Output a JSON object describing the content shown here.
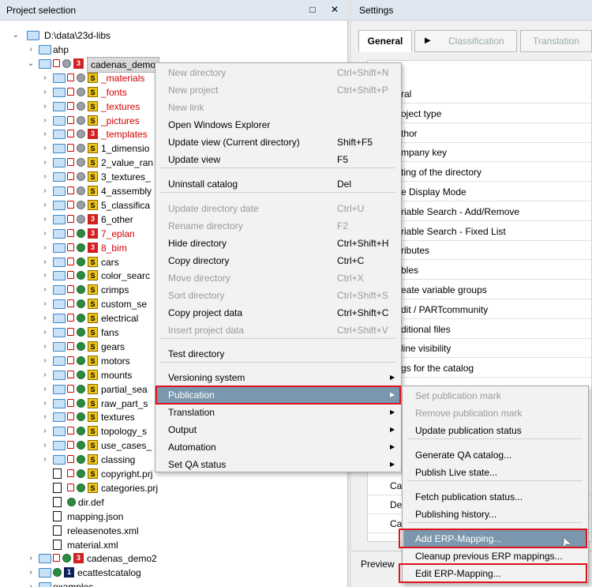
{
  "left_panel": {
    "title": "Project selection",
    "restore_icon": "□",
    "close_icon": "✕"
  },
  "right_panel": {
    "title": "Settings",
    "tabs": [
      {
        "label": "General",
        "active": true
      },
      {
        "label": "Classification",
        "active": false
      },
      {
        "label": "Translation",
        "active": false
      }
    ],
    "tab_play_icon": "▶",
    "properties": [
      "ral",
      "oject type",
      "thor",
      "mpany key",
      "ting of the directory",
      "e Display Mode",
      "riable Search - Add/Remove",
      "riable Search - Fixed List",
      "ributes",
      "bles",
      "eate variable groups",
      "dit / PARTcommunity",
      "ditional files",
      "line visibility",
      "gs for the catalog"
    ],
    "partial_rows": [
      "Ca",
      "De",
      "Ca"
    ],
    "preview_label": "Preview"
  },
  "tree": {
    "root": "D:\\data\\23d-libs",
    "items": [
      {
        "label": "ahp",
        "color": "#000"
      },
      {
        "label": "cadenas_demo",
        "color": "#000",
        "badge": "3",
        "badge_color": "#d02020",
        "selected": true
      },
      {
        "label": "_materials",
        "color": "#d40000",
        "badge": "S"
      },
      {
        "label": "_fonts",
        "color": "#d40000",
        "badge": "S"
      },
      {
        "label": "_textures",
        "color": "#d40000",
        "badge": "S"
      },
      {
        "label": "_pictures",
        "color": "#d40000",
        "badge": "S"
      },
      {
        "label": "_templates",
        "color": "#d40000",
        "badge": "3",
        "badge_color": "#d02020"
      },
      {
        "label": "1_dimensio",
        "color": "#000",
        "badge": "S"
      },
      {
        "label": "2_value_ran",
        "color": "#000",
        "badge": "S"
      },
      {
        "label": "3_textures_",
        "color": "#000",
        "badge": "S"
      },
      {
        "label": "4_assembly",
        "color": "#000",
        "badge": "S"
      },
      {
        "label": "5_classifica",
        "color": "#000",
        "badge": "S"
      },
      {
        "label": "6_other",
        "color": "#000",
        "badge": "3",
        "badge_color": "#d02020"
      },
      {
        "label": "7_eplan",
        "color": "#d40000",
        "badge": "3",
        "badge_color": "#d02020"
      },
      {
        "label": "8_bim",
        "color": "#d40000",
        "badge": "3",
        "badge_color": "#d02020"
      },
      {
        "label": "cars",
        "color": "#000",
        "badge": "S"
      },
      {
        "label": "color_searc",
        "color": "#000",
        "badge": "S"
      },
      {
        "label": "crimps",
        "color": "#000",
        "badge": "S"
      },
      {
        "label": "custom_se",
        "color": "#000",
        "badge": "S"
      },
      {
        "label": "electrical",
        "color": "#000",
        "badge": "S"
      },
      {
        "label": "fans",
        "color": "#000",
        "badge": "S"
      },
      {
        "label": "gears",
        "color": "#000",
        "badge": "S"
      },
      {
        "label": "motors",
        "color": "#000",
        "badge": "S"
      },
      {
        "label": "mounts",
        "color": "#000",
        "badge": "S"
      },
      {
        "label": "partial_sea",
        "color": "#000",
        "badge": "S"
      },
      {
        "label": "raw_part_s",
        "color": "#000",
        "badge": "S"
      },
      {
        "label": "textures",
        "color": "#000",
        "badge": "S"
      },
      {
        "label": "topology_s",
        "color": "#000",
        "badge": "S"
      },
      {
        "label": "use_cases_",
        "color": "#000",
        "badge": "S"
      },
      {
        "label": "classing",
        "color": "#000",
        "badge": "S"
      },
      {
        "label": "copyright.prj",
        "color": "#000",
        "badge": "S"
      },
      {
        "label": "categories.prj",
        "color": "#000",
        "badge": "S"
      },
      {
        "label": "dir.def",
        "color": "#000"
      },
      {
        "label": "mapping.json",
        "color": "#000"
      },
      {
        "label": "releasenotes.xml",
        "color": "#000"
      },
      {
        "label": "material.xml",
        "color": "#000"
      },
      {
        "label": "cadenas_demo2",
        "color": "#000",
        "badge": "3",
        "badge_color": "#d02020"
      },
      {
        "label": "ecattestcatalog",
        "color": "#000",
        "badge": "1",
        "badge_color": "#0b1d5b"
      },
      {
        "label": "examples",
        "color": "#000"
      }
    ]
  },
  "context_menu": {
    "items": [
      {
        "label": "New directory",
        "shortcut": "Ctrl+Shift+N",
        "disabled": true
      },
      {
        "label": "New project",
        "shortcut": "Ctrl+Shift+P",
        "disabled": true
      },
      {
        "label": "New link",
        "shortcut": "",
        "disabled": true
      },
      {
        "label": "Open Windows Explorer",
        "shortcut": "",
        "disabled": false
      },
      {
        "label": "Update view (Current directory)",
        "shortcut": "Shift+F5",
        "disabled": false
      },
      {
        "label": "Update view",
        "shortcut": "F5",
        "disabled": false
      },
      {
        "label": "Uninstall catalog",
        "shortcut": "Del",
        "disabled": false
      },
      {
        "label": "Update directory date",
        "shortcut": "Ctrl+U",
        "disabled": true
      },
      {
        "label": "Rename directory",
        "shortcut": "F2",
        "disabled": true
      },
      {
        "label": "Hide directory",
        "shortcut": "Ctrl+Shift+H",
        "disabled": false
      },
      {
        "label": "Copy directory",
        "shortcut": "Ctrl+C",
        "disabled": false
      },
      {
        "label": "Move directory",
        "shortcut": "Ctrl+X",
        "disabled": true
      },
      {
        "label": "Sort directory",
        "shortcut": "Ctrl+Shift+S",
        "disabled": true
      },
      {
        "label": "Copy project data",
        "shortcut": "Ctrl+Shift+C",
        "disabled": false
      },
      {
        "label": "Insert project data",
        "shortcut": "Ctrl+Shift+V",
        "disabled": true
      },
      {
        "label": "Test directory",
        "shortcut": "",
        "disabled": false
      },
      {
        "label": "Versioning system",
        "submenu": true
      },
      {
        "label": "Publication",
        "submenu": true,
        "highlighted": true
      },
      {
        "label": "Translation",
        "submenu": true
      },
      {
        "label": "Output",
        "submenu": true
      },
      {
        "label": "Automation",
        "submenu": true
      },
      {
        "label": "Set QA status",
        "submenu": true
      }
    ],
    "arrow_icon": "▶"
  },
  "submenu": {
    "items": [
      {
        "label": "Set publication mark",
        "disabled": true
      },
      {
        "label": "Remove publication mark",
        "disabled": true
      },
      {
        "label": "Update publication status",
        "disabled": false
      },
      {
        "label": "Generate QA catalog...",
        "disabled": false
      },
      {
        "label": "Publish Live state...",
        "disabled": false
      },
      {
        "label": "Fetch publication status...",
        "disabled": false
      },
      {
        "label": "Publishing history...",
        "disabled": false
      },
      {
        "label": "Add ERP-Mapping...",
        "disabled": false,
        "highlighted": true
      },
      {
        "label": "Cleanup previous ERP mappings...",
        "disabled": false
      },
      {
        "label": "Edit ERP-Mapping...",
        "disabled": false
      }
    ]
  },
  "colors": {
    "highlight": "#7b97ad",
    "annotation_red": "#e0121b",
    "header_blue": "#dfe7f1"
  }
}
